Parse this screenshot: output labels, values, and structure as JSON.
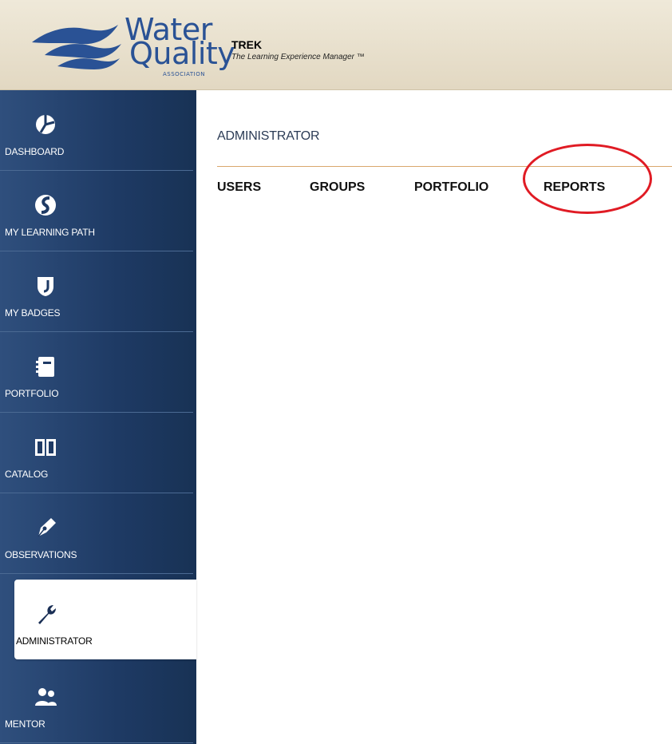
{
  "header": {
    "logo_word1": "Water",
    "logo_word2": "Quality",
    "logo_assoc": "ASSOCIATION",
    "app_title": "TREK",
    "app_subtitle": "The Learning Experience Manager ™"
  },
  "sidebar": {
    "items": [
      {
        "label": "DASHBOARD",
        "icon": "dashboard-pie-icon"
      },
      {
        "label": "MY LEARNING PATH",
        "icon": "learning-path-icon"
      },
      {
        "label": "MY BADGES",
        "icon": "badge-shield-icon"
      },
      {
        "label": "PORTFOLIO",
        "icon": "portfolio-notebook-icon"
      },
      {
        "label": "CATALOG",
        "icon": "catalog-book-icon"
      },
      {
        "label": "OBSERVATIONS",
        "icon": "pen-nib-icon"
      },
      {
        "label": "ADMINISTRATOR",
        "icon": "wrench-icon",
        "active": true
      },
      {
        "label": "MENTOR",
        "icon": "mentor-people-icon"
      }
    ]
  },
  "main": {
    "title": "ADMINISTRATOR",
    "tabs": [
      {
        "label": "USERS"
      },
      {
        "label": "GROUPS"
      },
      {
        "label": "PORTFOLIO"
      },
      {
        "label": "REPORTS",
        "highlighted": true
      }
    ]
  },
  "colors": {
    "sidebar": "#1e3a64",
    "brand_blue": "#2a5295",
    "tab_rule": "#d9a76d",
    "annotation": "#e01b24"
  }
}
